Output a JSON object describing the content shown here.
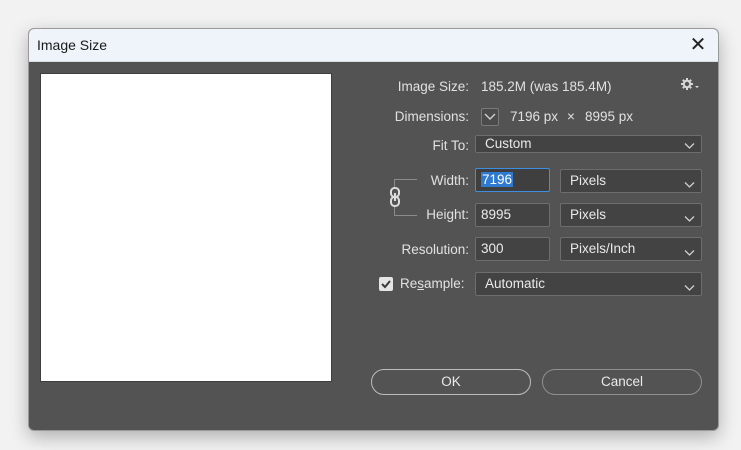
{
  "window": {
    "title": "Image Size",
    "close_glyph": "✕"
  },
  "info": {
    "image_size_label": "Image Size:",
    "image_size_value": "185.2M (was 185.4M)",
    "dimensions_label": "Dimensions:",
    "dim_width": "7196 px",
    "dim_times": "×",
    "dim_height": "8995 px"
  },
  "fit_to": {
    "label": "Fit To:",
    "value": "Custom"
  },
  "width": {
    "label": "Width:",
    "value": "7196",
    "unit": "Pixels"
  },
  "height": {
    "label": "Height:",
    "value": "8995",
    "unit": "Pixels"
  },
  "resolution": {
    "label": "Resolution:",
    "value": "300",
    "unit": "Pixels/Inch"
  },
  "resample": {
    "label_pre": "Re",
    "label_underlined": "s",
    "label_post": "ample:",
    "checked": true,
    "value": "Automatic"
  },
  "buttons": {
    "ok": "OK",
    "cancel": "Cancel"
  },
  "icons": {
    "gear": "gear-icon",
    "chain": "chain-link-icon",
    "check": "checkmark-icon",
    "chevron": "chevron-down-icon"
  }
}
